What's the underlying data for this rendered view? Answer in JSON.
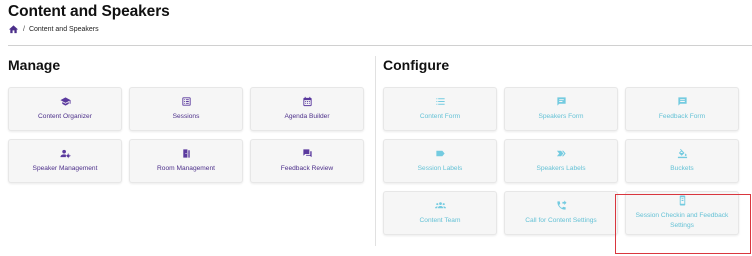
{
  "page": {
    "title": "Content and Speakers"
  },
  "breadcrumb": {
    "current": "Content and Speakers",
    "separator": "/"
  },
  "manage": {
    "title": "Manage",
    "items": [
      {
        "label": "Content Organizer",
        "icon": "graduation-cap-icon"
      },
      {
        "label": "Sessions",
        "icon": "list-box-icon"
      },
      {
        "label": "Agenda Builder",
        "icon": "calendar-icon"
      },
      {
        "label": "Speaker Management",
        "icon": "people-gear-icon"
      },
      {
        "label": "Room Management",
        "icon": "door-icon"
      },
      {
        "label": "Feedback Review",
        "icon": "chat-bubbles-icon"
      }
    ]
  },
  "configure": {
    "title": "Configure",
    "items": [
      {
        "label": "Content Form",
        "icon": "list-icon"
      },
      {
        "label": "Speakers Form",
        "icon": "speech-card-icon"
      },
      {
        "label": "Feedback Form",
        "icon": "comment-icon"
      },
      {
        "label": "Session Labels",
        "icon": "label-icon"
      },
      {
        "label": "Speakers Labels",
        "icon": "double-label-icon"
      },
      {
        "label": "Buckets",
        "icon": "paint-bucket-icon"
      },
      {
        "label": "Content Team",
        "icon": "group-icon"
      },
      {
        "label": "Call for Content Settings",
        "icon": "phone-forward-icon"
      },
      {
        "label": "Session Checkin and Feedback Settings",
        "icon": "mobile-phone-icon"
      }
    ]
  },
  "colors": {
    "manage_accent": "#5b3a9e",
    "configure_accent": "#74cbe0",
    "highlight": "#d9363e"
  }
}
